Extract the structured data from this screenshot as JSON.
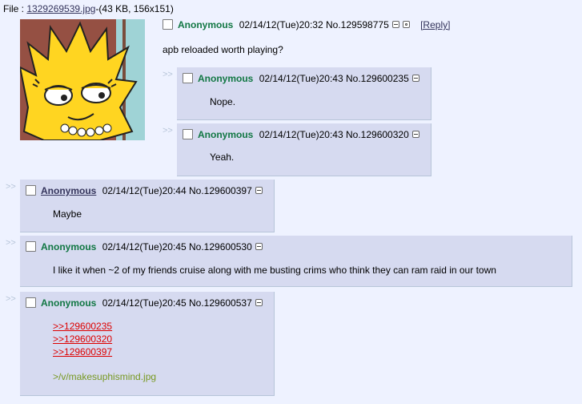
{
  "file": {
    "prefix": "File : ",
    "filename": "1329269539.jpg",
    "info": "-(43 KB, 156x151)"
  },
  "op": {
    "name": "Anonymous",
    "datetime": "02/14/12(Tue)20:32",
    "number": "No.129598775",
    "reply_label": "[Reply]",
    "message": "apb reloaded worth playing?"
  },
  "arrow": ">>",
  "replies": [
    {
      "name": "Anonymous",
      "datetime": "02/14/12(Tue)20:43",
      "number": "No.129600235",
      "message": "Nope."
    },
    {
      "name": "Anonymous",
      "datetime": "02/14/12(Tue)20:43",
      "number": "No.129600320",
      "message": "Yeah."
    },
    {
      "name": "Anonymous",
      "datetime": "02/14/12(Tue)20:44",
      "number": "No.129600397",
      "message": "Maybe"
    },
    {
      "name": "Anonymous",
      "datetime": "02/14/12(Tue)20:45",
      "number": "No.129600530",
      "message": "I like it when ~2 of my friends cruise along with me busting crims who think they can ram raid in our town"
    },
    {
      "name": "Anonymous",
      "datetime": "02/14/12(Tue)20:45",
      "number": "No.129600537",
      "quotes": [
        ">>129600235",
        ">>129600320",
        ">>129600397"
      ],
      "greentext": ">/v/makesuphismind.jpg"
    }
  ],
  "colors": {
    "background": "#eef2ff",
    "reply_bg": "#d6daf0",
    "name_green": "#117743",
    "quote_red": "#dd0000",
    "greentext": "#789922"
  }
}
